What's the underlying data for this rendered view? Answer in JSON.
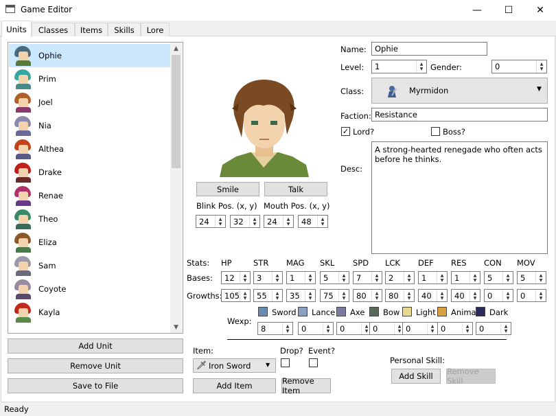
{
  "window": {
    "title": "Game Editor",
    "minimize": "—",
    "maximize": "☐",
    "close": "✕"
  },
  "tabs": [
    "Units",
    "Classes",
    "Items",
    "Skills",
    "Lore"
  ],
  "units": [
    {
      "name": "Ophie",
      "hair": "#4a6a7a",
      "body": "#5a7a3a"
    },
    {
      "name": "Prim",
      "hair": "#3aa6a0",
      "body": "#4a8a8a"
    },
    {
      "name": "Joel",
      "hair": "#b0602a",
      "body": "#8a3a6a"
    },
    {
      "name": "Nia",
      "hair": "#8a8ab0",
      "body": "#6a6a9a"
    },
    {
      "name": "Althea",
      "hair": "#c0441a",
      "body": "#5a5a8a"
    },
    {
      "name": "Drake",
      "hair": "#c0201a",
      "body": "#6a2a2a"
    },
    {
      "name": "Renae",
      "hair": "#b0306a",
      "body": "#6a3a8a"
    },
    {
      "name": "Theo",
      "hair": "#3a8a6a",
      "body": "#3a6a5a"
    },
    {
      "name": "Eliza",
      "hair": "#8a5a2a",
      "body": "#4a7a4a"
    },
    {
      "name": "Sam",
      "hair": "#9a9aa8",
      "body": "#6a6a7a"
    },
    {
      "name": "Coyote",
      "hair": "#9a8aa0",
      "body": "#5a4a6a"
    },
    {
      "name": "Kayla",
      "hair": "#c02a1a",
      "body": "#5a8a4a"
    }
  ],
  "list_buttons": {
    "add": "Add Unit",
    "remove": "Remove Unit",
    "save": "Save to File"
  },
  "portrait": {
    "smile": "Smile",
    "talk": "Talk",
    "blink_label": "Blink Pos. (x, y)",
    "mouth_label": "Mouth Pos. (x, y)",
    "blink_x": "24",
    "blink_y": "32",
    "mouth_x": "24",
    "mouth_y": "48"
  },
  "fields": {
    "name_label": "Name:",
    "name": "Ophie",
    "level_label": "Level:",
    "level": "1",
    "gender_label": "Gender:",
    "gender": "0",
    "class_label": "Class:",
    "class": "Myrmidon",
    "faction_label": "Faction:",
    "faction": "Resistance",
    "lord_label": "Lord?",
    "lord_checked": true,
    "boss_label": "Boss?",
    "boss_checked": false,
    "desc_label": "Desc:",
    "desc": "A strong-hearted renegade who often acts before he thinks."
  },
  "stats": {
    "label": "Stats:",
    "bases_label": "Bases:",
    "growths_label": "Growths:",
    "headers": [
      "HP",
      "STR",
      "MAG",
      "SKL",
      "SPD",
      "LCK",
      "DEF",
      "RES",
      "CON",
      "MOV"
    ],
    "bases": [
      "12",
      "3",
      "1",
      "5",
      "7",
      "2",
      "1",
      "1",
      "5",
      "5"
    ],
    "growths": [
      "105",
      "55",
      "35",
      "75",
      "80",
      "80",
      "40",
      "40",
      "0",
      "0"
    ]
  },
  "wexp": {
    "label": "Wexp:",
    "types": [
      {
        "name": "Sword",
        "color": "#6a8ab0"
      },
      {
        "name": "Lance",
        "color": "#8aa0c0"
      },
      {
        "name": "Axe",
        "color": "#7a7aa0"
      },
      {
        "name": "Bow",
        "color": "#5a6a5a"
      },
      {
        "name": "Light",
        "color": "#e8d890"
      },
      {
        "name": "Anima",
        "color": "#d8a040"
      },
      {
        "name": "Dark",
        "color": "#2a2a5a"
      }
    ],
    "values": [
      "8",
      "0",
      "0",
      "0",
      "0",
      "0",
      "0"
    ]
  },
  "items": {
    "label": "Item:",
    "selected": "Iron Sword",
    "drop_label": "Drop?",
    "event_label": "Event?",
    "add": "Add Item",
    "remove": "Remove Item"
  },
  "skills": {
    "label": "Personal Skill:",
    "add": "Add Skill",
    "remove": "Remove Skill"
  },
  "status": "Ready"
}
